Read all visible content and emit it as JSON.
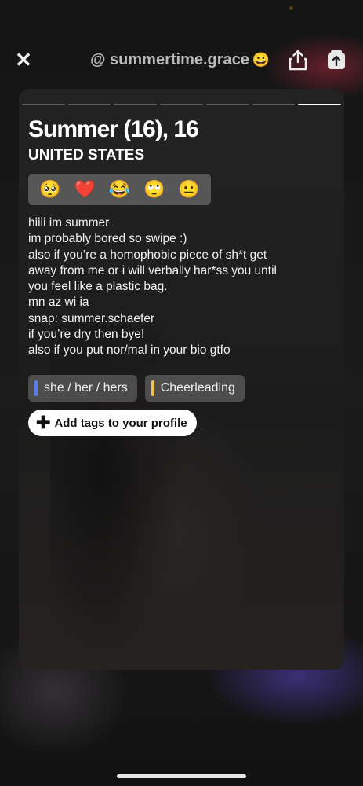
{
  "header": {
    "close_icon": "close-icon",
    "handle": "@ summertime.grace",
    "handle_emoji": "😀",
    "share_icon": "share-icon",
    "tag_icon": "tag-icon"
  },
  "card": {
    "progress_segments": 7,
    "active_segment": 6,
    "name": "Summer (16), 16",
    "country": "UNITED STATES",
    "emojis": [
      "🥺",
      "❤️",
      "😂",
      "🙄",
      "😐"
    ],
    "bio_lines": [
      "hiiii im summer",
      "im probably bored so swipe :)",
      "also if you’re a homophobic piece of sh*t get",
      "away from me or i will verbally har*ss you until",
      "you feel like a plastic bag.",
      "mn az wi ia",
      "snap: summer.schaefer",
      "if you’re dry then bye!",
      "also if you put nor/mal in your bio gtfo"
    ],
    "tags": [
      {
        "label": "she / her / hers",
        "color": "#5b7cf0"
      },
      {
        "label": "Cheerleading",
        "color": "#f2c14e"
      }
    ],
    "add_tags_label": "Add tags to your profile"
  },
  "colors": {
    "card_bg": "#1f1f1f",
    "tag_bg": "#6e6e6e",
    "handle_text": "#b9b9b9"
  }
}
